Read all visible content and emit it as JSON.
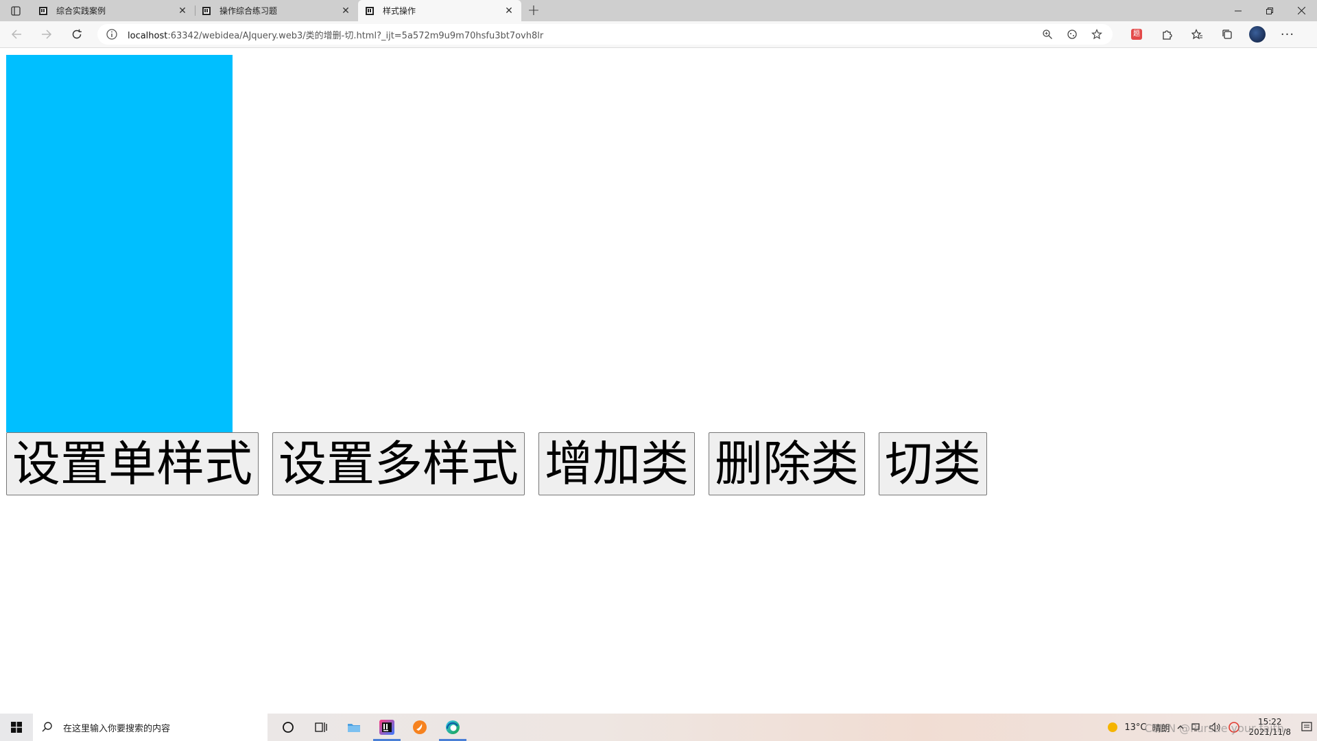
{
  "browser": {
    "tabs": [
      {
        "title": "综合实践案例",
        "active": false
      },
      {
        "title": "操作综合练习题",
        "active": false
      },
      {
        "title": "样式操作",
        "active": true
      }
    ],
    "new_tab": "+",
    "url_host": "localhost",
    "url_rest": ":63342/webidea/AJquery.web3/类的增删-切.html?_ijt=5a572m9u9m70hsfu3bt7ovh8lr",
    "extension_badge": "题"
  },
  "page": {
    "box_color": "#00bfff",
    "buttons": [
      "设置单样式",
      "设置多样式",
      "增加类",
      "删除类",
      "切类"
    ]
  },
  "taskbar": {
    "search_placeholder": "在这里输入你要搜索的内容",
    "weather_temp": "13°C",
    "weather_desc": "晴朗",
    "time": "15:22",
    "date": "2021/11/8",
    "watermark": "CSDN @Pursue your faith"
  }
}
